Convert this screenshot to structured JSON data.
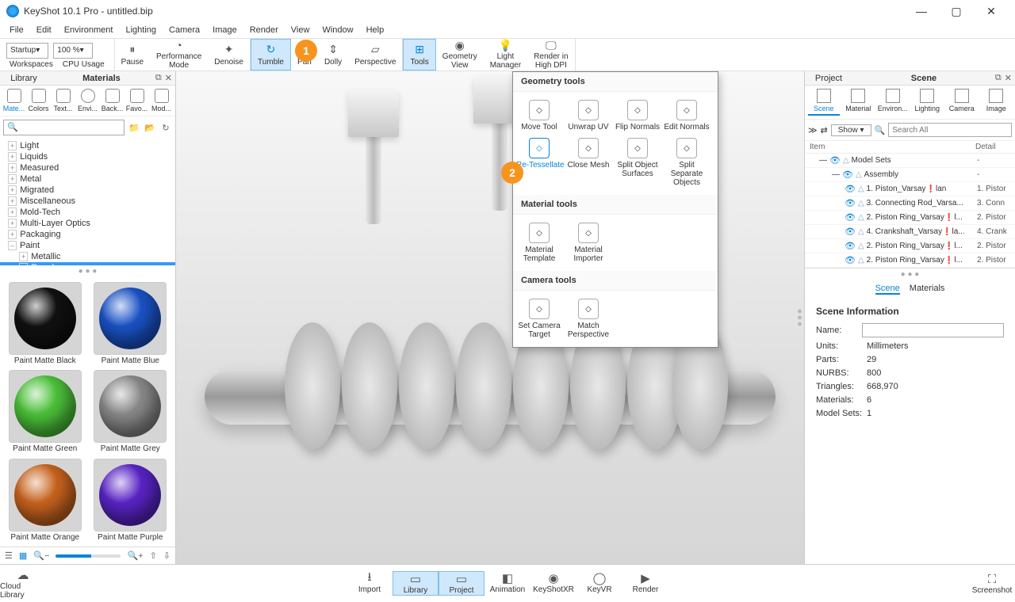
{
  "title": "KeyShot 10.1 Pro  - untitled.bip",
  "menus": [
    "File",
    "Edit",
    "Environment",
    "Lighting",
    "Camera",
    "Image",
    "Render",
    "View",
    "Window",
    "Help"
  ],
  "toolbar": {
    "startup": "Startup",
    "pct": "100 %",
    "items": [
      {
        "l": "Workspaces",
        "g": 0
      },
      {
        "l": "CPU Usage",
        "g": 0
      },
      {
        "l": "Pause",
        "g": 0
      },
      {
        "l": "Performance\nMode",
        "g": 0
      },
      {
        "l": "Denoise",
        "g": 0
      },
      {
        "l": "Tumble",
        "g": 1,
        "a": 1
      },
      {
        "l": "Pan",
        "g": 1
      },
      {
        "l": "Dolly",
        "g": 1
      },
      {
        "l": "Perspective",
        "g": 1
      },
      {
        "l": "Tools",
        "g": 2,
        "a": 1
      },
      {
        "l": "Geometry\nView",
        "g": 2
      },
      {
        "l": "Light\nManager",
        "g": 2
      },
      {
        "l": "Render in\nHigh DPI",
        "g": 2
      }
    ]
  },
  "left": {
    "tab1": "Library",
    "tab2": "Materials",
    "cats": [
      "Mate...",
      "Colors",
      "Text...",
      "Envi...",
      "Back...",
      "Favo...",
      "Mod..."
    ],
    "search_ph": "🔍",
    "tree": [
      "Light",
      "Liquids",
      "Measured",
      "Metal",
      "Migrated",
      "Miscellaneous",
      "Mold-Tech",
      "Multi-Layer Optics",
      "Packaging"
    ],
    "paint": "Paint",
    "paint_children": [
      "Metallic",
      "Rough"
    ],
    "swatches": [
      {
        "n": "Paint Matte Black",
        "c": "#111"
      },
      {
        "n": "Paint Matte Blue",
        "c": "#1a53c7"
      },
      {
        "n": "Paint Matte Green",
        "c": "#4cc23a"
      },
      {
        "n": "Paint Matte Grey",
        "c": "#8a8a8a"
      },
      {
        "n": "Paint Matte Orange",
        "c": "#c9641f"
      },
      {
        "n": "Paint Matte Purple",
        "c": "#5a24c7"
      }
    ]
  },
  "popup": {
    "geom": "Geometry tools",
    "geom_items": [
      "Move Tool",
      "Unwrap UV",
      "Flip Normals",
      "Edit Normals",
      "Re-Tessellate",
      "Close Mesh",
      "Split Object\nSurfaces",
      "Split\nSeparate\nObjects"
    ],
    "mat": "Material tools",
    "mat_items": [
      "Material\nTemplate",
      "Material\nImporter"
    ],
    "cam": "Camera tools",
    "cam_items": [
      "Set Camera\nTarget",
      "Match\nPerspective"
    ]
  },
  "right": {
    "tab1": "Project",
    "tab2": "Scene",
    "cats": [
      "Scene",
      "Material",
      "Environ...",
      "Lighting",
      "Camera",
      "Image"
    ],
    "show": "Show",
    "search_ph": "Search All",
    "hdr_item": "Item",
    "hdr_det": "Detail",
    "rows": [
      {
        "lv": 0,
        "n": "Model Sets",
        "d": "-"
      },
      {
        "lv": 1,
        "n": "Assembly",
        "d": "-"
      },
      {
        "lv": 2,
        "n": "1. Piston_Varsay❗lan",
        "d": "1. Pistor"
      },
      {
        "lv": 2,
        "n": "3. Connecting Rod_Varsa...",
        "d": "3. Conn"
      },
      {
        "lv": 2,
        "n": "2. Piston Ring_Varsay❗l...",
        "d": "2. Pistor"
      },
      {
        "lv": 2,
        "n": "4. Crankshaft_Varsay❗la...",
        "d": "4. Crank"
      },
      {
        "lv": 2,
        "n": "2. Piston Ring_Varsay❗l...",
        "d": "2. Pistor"
      },
      {
        "lv": 2,
        "n": "2. Piston Ring_Varsay❗l...",
        "d": "2. Pistor"
      }
    ],
    "tabs": [
      "Scene",
      "Materials"
    ],
    "info_title": "Scene Information",
    "info": [
      {
        "k": "Name:",
        "v": ""
      },
      {
        "k": "Units:",
        "v": "Millimeters"
      },
      {
        "k": "Parts:",
        "v": "29"
      },
      {
        "k": "NURBS:",
        "v": "800"
      },
      {
        "k": "Triangles:",
        "v": "668,970"
      },
      {
        "k": "Materials:",
        "v": "6"
      },
      {
        "k": "Model Sets:",
        "v": "1"
      }
    ]
  },
  "bottom": {
    "left": "Cloud Library",
    "mid": [
      "Import",
      "Library",
      "Project",
      "Animation",
      "KeyShotXR",
      "KeyVR",
      "Render"
    ],
    "right": "Screenshot"
  }
}
